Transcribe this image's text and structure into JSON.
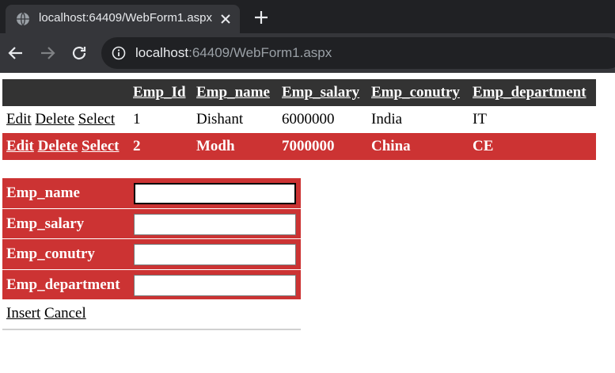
{
  "browser": {
    "tab_title": "localhost:64409/WebForm1.aspx",
    "url_host": "localhost",
    "url_rest": ":64409/WebForm1.aspx"
  },
  "grid": {
    "headers": [
      "Emp_Id",
      "Emp_name",
      "Emp_salary",
      "Emp_conutry",
      "Emp_department"
    ],
    "actions": {
      "edit": "Edit",
      "delete": "Delete",
      "select": "Select"
    },
    "rows": [
      {
        "id": "1",
        "name": "Dishant",
        "salary": "6000000",
        "country": "India",
        "department": "IT",
        "selected": false
      },
      {
        "id": "2",
        "name": "Modh",
        "salary": "7000000",
        "country": "China",
        "department": "CE",
        "selected": true
      }
    ]
  },
  "form": {
    "fields": [
      {
        "label": "Emp_name",
        "value": ""
      },
      {
        "label": "Emp_salary",
        "value": ""
      },
      {
        "label": "Emp_conutry",
        "value": ""
      },
      {
        "label": "Emp_department",
        "value": ""
      }
    ],
    "insert_label": "Insert",
    "cancel_label": "Cancel"
  },
  "colors": {
    "header_bg": "#333333",
    "selected_bg": "#cc3333",
    "tabstrip_bg": "#202124",
    "toolbar_bg": "#35363a"
  }
}
